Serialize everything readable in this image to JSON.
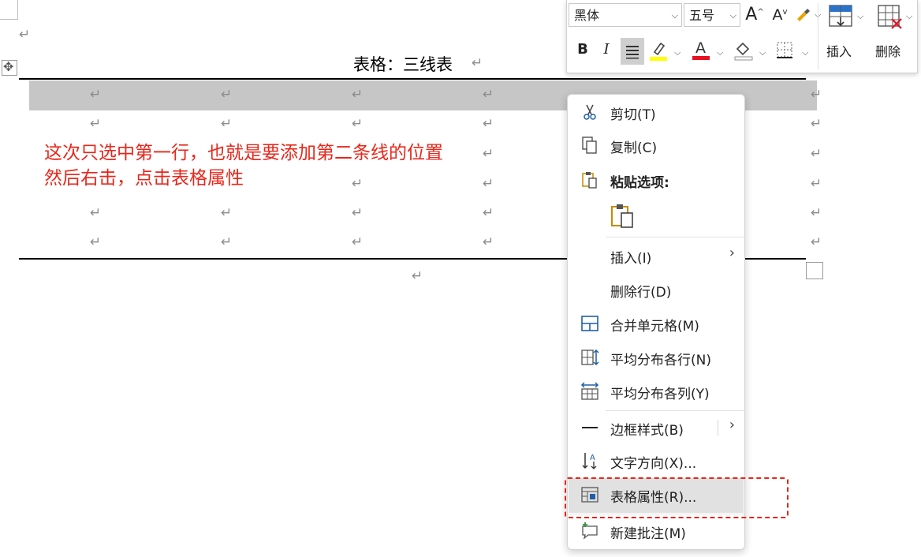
{
  "document": {
    "paragraph_mark": "↵",
    "table_title": "表格：三线表",
    "annotation_line1": "这次只选中第一行，也就是要添加第二条线的位置",
    "annotation_line2": "然后右击，点击表格属性",
    "move_handle_glyph": "✥"
  },
  "mini_toolbar": {
    "font_name": "黑体",
    "font_size": "五号",
    "grow_font": "A",
    "shrink_font": "A",
    "bold": "B",
    "italic": "I",
    "insert_label": "插入",
    "delete_label": "删除",
    "highlight_color": "#ffff00",
    "font_color": "#e81123",
    "align_selected": true
  },
  "context_menu": {
    "items": [
      {
        "label": "剪切(T)",
        "icon": "scissors-icon"
      },
      {
        "label": "复制(C)",
        "icon": "copy-icon"
      },
      {
        "label": "粘贴选项:",
        "icon": "paste-icon"
      },
      {
        "label": "插入(I)",
        "has_submenu": true
      },
      {
        "label": "删除行(D)"
      },
      {
        "label": "合并单元格(M)",
        "icon": "merge-cells-icon"
      },
      {
        "label": "平均分布各行(N)",
        "icon": "distribute-rows-icon"
      },
      {
        "label": "平均分布各列(Y)",
        "icon": "distribute-columns-icon"
      },
      {
        "label": "边框样式(B)",
        "icon": "border-style-icon",
        "has_submenu": true
      },
      {
        "label": "文字方向(X)...",
        "icon": "text-direction-icon"
      },
      {
        "label": "表格属性(R)...",
        "icon": "table-properties-icon",
        "hovered": true
      },
      {
        "label": "新建批注(M)",
        "icon": "new-comment-icon"
      }
    ],
    "submenu_arrow": "›",
    "accent_color": "#1f5fa8",
    "highlight_color": "#e8261a"
  }
}
